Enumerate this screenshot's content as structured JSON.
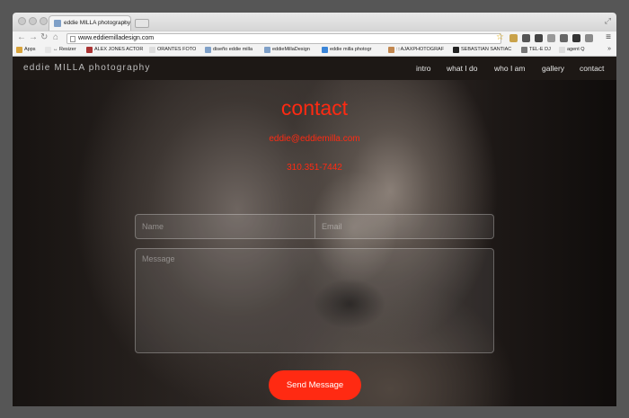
{
  "browser": {
    "tab_title": "eddie MILLA photography",
    "url": "www.eddiemilladesign.com",
    "bookmarks": [
      {
        "label": "Apps",
        "color": "#d8a33a"
      },
      {
        "label": "↔ Resizer",
        "color": "#e5e5e5"
      },
      {
        "label": "ALEX JONES ACTOR",
        "color": "#a33"
      },
      {
        "label": "ORANTES FOTO",
        "color": "#ddd"
      },
      {
        "label": "diseño eddie milla",
        "color": "#7fa0c8"
      },
      {
        "label": "eddieMillaDesign",
        "color": "#7fa0c8"
      },
      {
        "label": "eddie milla photogr",
        "color": "#3b86d9"
      },
      {
        "label": ":::AJAXPHOTOGRAF",
        "color": "#c2874f"
      },
      {
        "label": "SEBASTIAN SANTIAC",
        "color": "#222"
      },
      {
        "label": "TEL-E DJ",
        "color": "#777"
      },
      {
        "label": "agent Q",
        "color": "#ddd"
      }
    ]
  },
  "site": {
    "brand": "eddie MILLA photography",
    "nav": [
      "intro",
      "what I do",
      "who I am",
      "gallery",
      "contact"
    ],
    "heading": "contact",
    "email": "eddie@eddiemilla.com",
    "phone": "310.351-7442",
    "form": {
      "name_placeholder": "Name",
      "email_placeholder": "Email",
      "message_placeholder": "Message",
      "submit_label": "Send Message"
    },
    "accent_color": "#ff2a12"
  }
}
